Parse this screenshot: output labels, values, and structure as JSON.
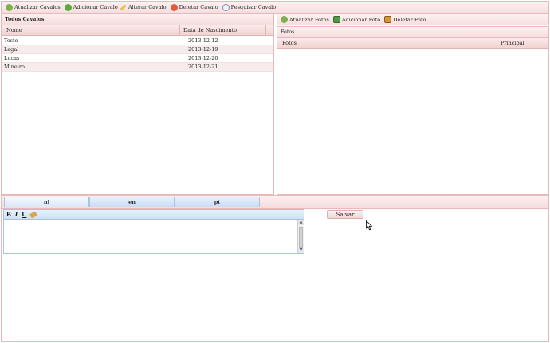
{
  "top_toolbar": {
    "buttons": [
      {
        "label": "Atualizar Cavalos",
        "icon": "refresh-icon"
      },
      {
        "label": "Adicionar Cavalo",
        "icon": "add-icon"
      },
      {
        "label": "Alterar Cavalo",
        "icon": "pencil-icon"
      },
      {
        "label": "Deletar Cavalo",
        "icon": "delete-icon"
      },
      {
        "label": "Pesquisar Cavalo",
        "icon": "search-icon"
      }
    ]
  },
  "horses_panel": {
    "title": "Todos Cavalos",
    "columns": [
      "Nome",
      "Data de Nascimento"
    ],
    "rows": [
      {
        "name": "Teste",
        "birth": "2013-12-12"
      },
      {
        "name": "Legal",
        "birth": "2013-12-19"
      },
      {
        "name": "Lucas",
        "birth": "2013-12-20"
      },
      {
        "name": "Mineiro",
        "birth": "2013-12-21"
      }
    ]
  },
  "photos_toolbar": {
    "buttons": [
      {
        "label": "Atualizar Fotos",
        "icon": "refresh-icon"
      },
      {
        "label": "Adicionar Foto",
        "icon": "add-photo-icon"
      },
      {
        "label": "Deletar Foto",
        "icon": "delete-photo-icon"
      }
    ]
  },
  "photos_panel": {
    "title": "Fotos",
    "columns": [
      "Fotos",
      "Principal"
    ]
  },
  "tabs": {
    "items": [
      "nl",
      "en",
      "pt"
    ],
    "active": "nl"
  },
  "editor": {
    "format_buttons": [
      "B",
      "I",
      "U"
    ]
  },
  "save_button": "Salvar",
  "colors": {
    "accent_pink": "#f7dede",
    "border_pink": "#e7b9b9",
    "tab_blue": "#c9dcf2"
  }
}
